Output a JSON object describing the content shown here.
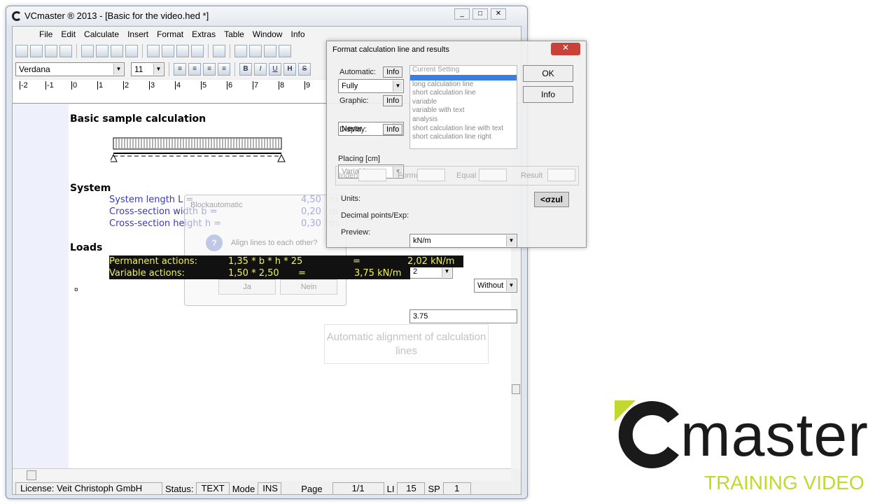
{
  "window": {
    "title": "VCmaster ® 2013 - [Basic for the video.hed *]"
  },
  "menu": [
    "File",
    "Edit",
    "Calculate",
    "Insert",
    "Format",
    "Extras",
    "Table",
    "Window",
    "Info"
  ],
  "toolbar": {
    "icons": [
      "new-file-icon",
      "open-icon",
      "save-icon",
      "pdf-icon",
      "preview-icon",
      "delete-icon",
      "print-icon",
      "spellcheck-icon",
      "cut-icon",
      "copy-icon",
      "paste-icon",
      "clear-format-icon",
      "undo-icon",
      "find-icon",
      "variable-icon",
      "table-icon",
      "color-icon"
    ]
  },
  "format_bar": {
    "font": "Verdana",
    "size": "11",
    "bold": "B",
    "italic": "I",
    "underline": "U",
    "h": "H",
    "strike": "S"
  },
  "ruler": [
    "-2",
    "-1",
    "0",
    "1",
    "2",
    "3",
    "4",
    "5",
    "6",
    "7",
    "8",
    "9"
  ],
  "document": {
    "title": "Basic sample calculation",
    "system_heading": "System",
    "system_rows": [
      {
        "label": "System length L =",
        "value": "4,50",
        "unit": "m"
      },
      {
        "label": "Cross-section width b =",
        "value": "0,20",
        "unit": "m"
      },
      {
        "label": "Cross-section height h =",
        "value": "0,30",
        "unit": "m"
      }
    ],
    "loads_heading": "Loads",
    "loads_rows": [
      {
        "label": "Permanent actions:",
        "formula": "1,35 * b * h * 25",
        "eq": "=",
        "result": "2,02 kN/m"
      },
      {
        "label": "Variable actions:",
        "formula": "1,50 * 2,50",
        "eq": "=",
        "result": "3,75 kN/m"
      }
    ],
    "para_mark": "¤"
  },
  "status": {
    "license": "License: Veit Christoph GmbH",
    "status_label": "Status:",
    "status_value": "TEXT",
    "mode_label": "Mode",
    "mode_value": "INS",
    "page_label": "Page",
    "page_value": "1/1",
    "li_label": "LI",
    "li_value": "15",
    "sp_label": "SP",
    "sp_value": "1"
  },
  "format_dialog": {
    "title": "Format calculation line and results",
    "automatic_label": "Automatic:",
    "info": "Info",
    "automatic_value": "Fully",
    "graphic_label": "Graphic:",
    "graphic_value": "Never",
    "display_label": "Display:",
    "display_value": "Variables",
    "list": [
      "Current Setting",
      "",
      "long calculation line",
      "short calculation line",
      "variable",
      "variable with text",
      "analysis",
      "short calculation line with text",
      "short calculation line right"
    ],
    "placing": "Placing [cm]",
    "indent": "Indent",
    "formula": "Formula",
    "equal": "Equal",
    "result": "Result",
    "units_label": "Units:",
    "units_value": "kN/m",
    "decimal_label": "Decimal points/Exp:",
    "decimal_value": "2",
    "exp_value": "Without",
    "preview_label": "Preview:",
    "preview_value": "3.75",
    "ok": "OK",
    "info_btn": "Info",
    "sigma": "<σzul"
  },
  "block_dialog": {
    "title": "Blockautomatic",
    "question": "Align lines to each other?",
    "yes": "Ja",
    "no": "Nein"
  },
  "tooltip": "Automatic alignment of calculation lines",
  "brand": {
    "name": "master",
    "subtitle": "TRAINING VIDEO",
    "accent": "#c3d82e"
  }
}
